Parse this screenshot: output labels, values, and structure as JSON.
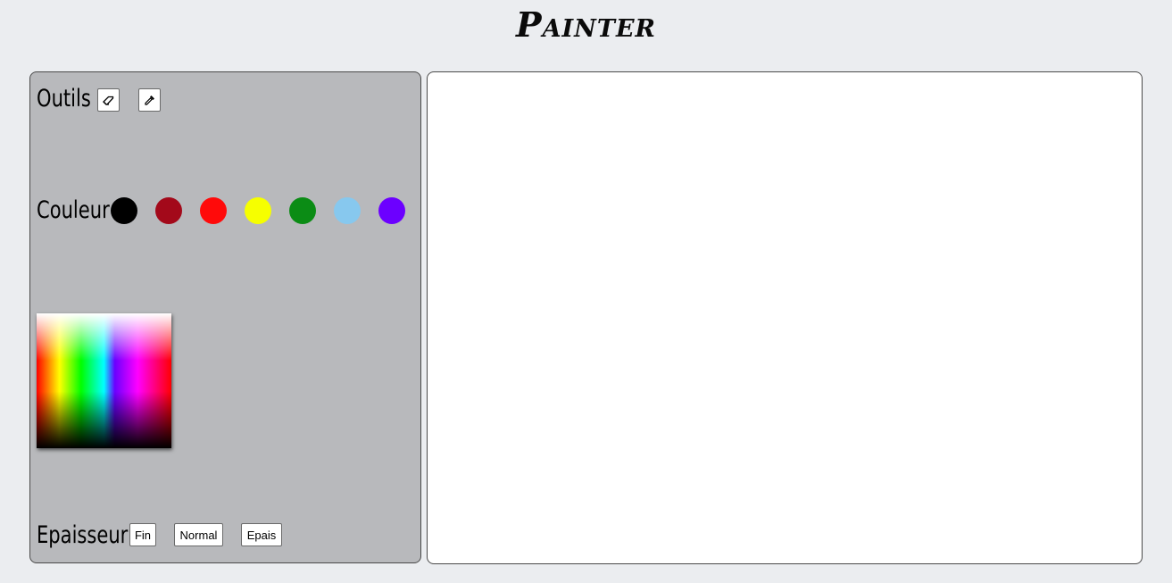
{
  "app": {
    "title": "Painter"
  },
  "tools": {
    "label": "Outils",
    "eraser_icon": "eraser-icon",
    "eyedropper_icon": "eyedropper-icon"
  },
  "colors": {
    "label": "Couleur",
    "swatches": [
      "#000000",
      "#a3091a",
      "#ff0a0a",
      "#f6ff00",
      "#0b8c15",
      "#87c8ee",
      "#6c00ff"
    ]
  },
  "thickness": {
    "label": "Epaisseur",
    "options": [
      "Fin",
      "Normal",
      "Epais"
    ]
  }
}
